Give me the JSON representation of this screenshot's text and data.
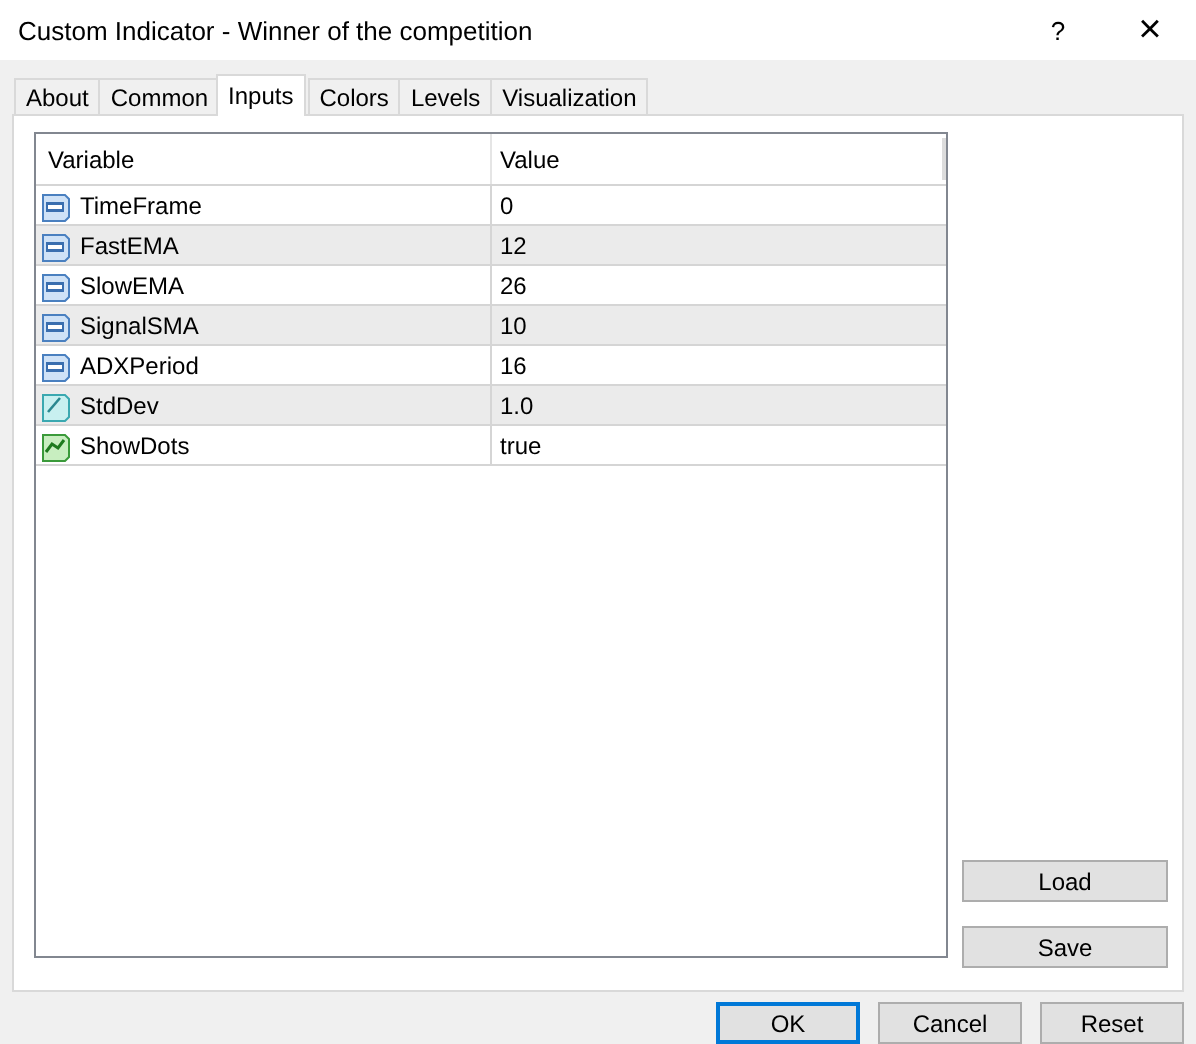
{
  "window": {
    "title": "Custom Indicator - Winner of the competition",
    "help": "?",
    "close": "×"
  },
  "tabs": [
    {
      "label": "About",
      "selected": false
    },
    {
      "label": "Common",
      "selected": false
    },
    {
      "label": "Inputs",
      "selected": true
    },
    {
      "label": "Colors",
      "selected": false
    },
    {
      "label": "Levels",
      "selected": false
    },
    {
      "label": "Visualization",
      "selected": false
    }
  ],
  "table": {
    "columns": [
      "Variable",
      "Value"
    ],
    "rows": [
      {
        "kind": "int",
        "variable": "TimeFrame",
        "value": "0"
      },
      {
        "kind": "int",
        "variable": "FastEMA",
        "value": "12"
      },
      {
        "kind": "int",
        "variable": "SlowEMA",
        "value": "26"
      },
      {
        "kind": "int",
        "variable": "SignalSMA",
        "value": "10"
      },
      {
        "kind": "int",
        "variable": "ADXPeriod",
        "value": "16"
      },
      {
        "kind": "double",
        "variable": "StdDev",
        "value": "1.0"
      },
      {
        "kind": "bool",
        "variable": "ShowDots",
        "value": "true"
      }
    ]
  },
  "side_buttons": [
    "Load",
    "Save"
  ],
  "buttons": [
    {
      "label": "OK",
      "default": true
    },
    {
      "label": "Cancel",
      "default": false
    },
    {
      "label": "Reset",
      "default": false
    }
  ]
}
